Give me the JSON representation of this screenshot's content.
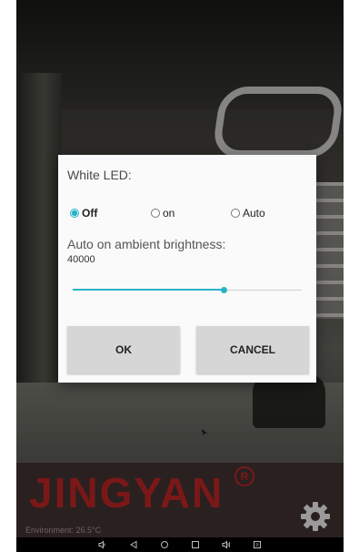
{
  "dialog": {
    "title": "White LED:",
    "radios": [
      {
        "label": "Off",
        "checked": true
      },
      {
        "label": "on",
        "checked": false
      },
      {
        "label": "Auto",
        "checked": false
      }
    ],
    "ambient_label": "Auto on ambient brightness:",
    "ambient_value": "40000",
    "slider_fraction": 0.66,
    "ok_label": "OK",
    "cancel_label": "CANCEL"
  },
  "logo": {
    "text": "JINGYAN",
    "reg_mark": "R",
    "color": "#7a1818"
  },
  "status": {
    "environment": "Environment: 26.5°C"
  },
  "nav": {
    "icons": [
      "volume-down-icon",
      "back-icon",
      "home-icon",
      "recents-icon",
      "volume-up-icon",
      "screenshot-icon"
    ]
  },
  "colors": {
    "accent": "#2ab3c6",
    "dialog_bg": "#fafafa",
    "button_bg": "#d6d6d6"
  }
}
